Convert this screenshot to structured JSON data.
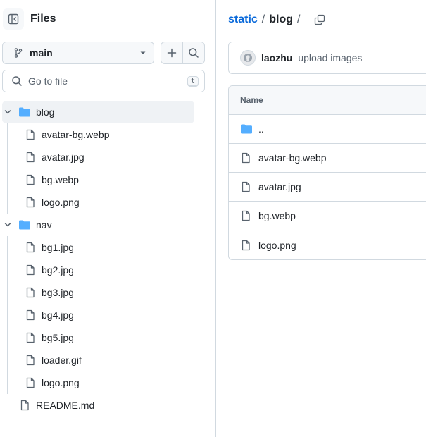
{
  "sidebar": {
    "title": "Files",
    "branch": "main",
    "search_placeholder": "Go to file",
    "search_shortcut": "t",
    "tree": {
      "blog": {
        "name": "blog",
        "files": [
          "avatar-bg.webp",
          "avatar.jpg",
          "bg.webp",
          "logo.png"
        ]
      },
      "nav": {
        "name": "nav",
        "files": [
          "bg1.jpg",
          "bg2.jpg",
          "bg3.jpg",
          "bg4.jpg",
          "bg5.jpg",
          "loader.gif",
          "logo.png"
        ]
      },
      "root_files": [
        "README.md"
      ]
    }
  },
  "breadcrumb": {
    "root": "static",
    "sep": "/",
    "current": "blog"
  },
  "commit": {
    "author": "laozhu",
    "message": "upload images"
  },
  "table": {
    "header_name": "Name",
    "parent": "..",
    "rows": [
      "avatar-bg.webp",
      "avatar.jpg",
      "bg.webp",
      "logo.png"
    ]
  },
  "colors": {
    "accent": "#0969da",
    "folder": "#54aeff",
    "border": "#d1d9e0"
  }
}
